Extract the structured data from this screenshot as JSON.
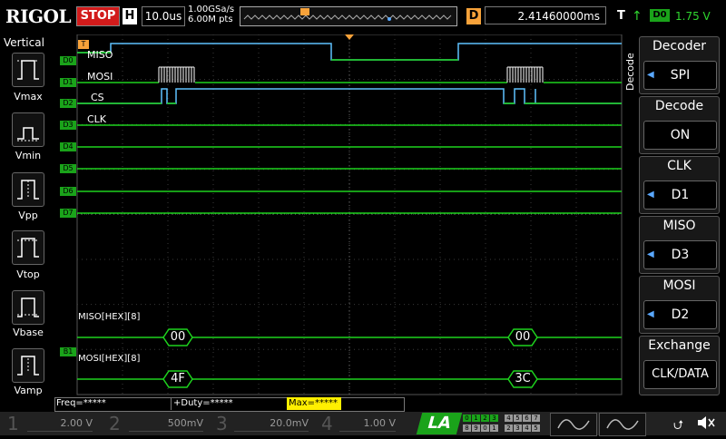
{
  "brand": "RIGOL",
  "run_state": "STOP",
  "horizontal": {
    "badge": "H",
    "timebase": "10.0us",
    "sample_rate": "1.00GSa/s",
    "memory": "6.00M pts"
  },
  "delay": {
    "badge": "D",
    "value": "2.41460000ms"
  },
  "trigger": {
    "badge": "T",
    "slope_icon": "rising-edge-icon",
    "source": "D0",
    "level": "1.75 V"
  },
  "vertical_menu": {
    "title": "Vertical",
    "items": [
      {
        "label": "Vmax"
      },
      {
        "label": "Vmin"
      },
      {
        "label": "Vpp"
      },
      {
        "label": "Vtop"
      },
      {
        "label": "Vbase"
      },
      {
        "label": "Vamp"
      }
    ]
  },
  "digital_channels": [
    {
      "id": "D0",
      "signal": "MISO"
    },
    {
      "id": "D1",
      "signal": "MOSI"
    },
    {
      "id": "D2",
      "signal": "CS"
    },
    {
      "id": "D3",
      "signal": "CLK"
    },
    {
      "id": "D4",
      "signal": ""
    },
    {
      "id": "D5",
      "signal": ""
    },
    {
      "id": "D6",
      "signal": ""
    },
    {
      "id": "D7",
      "signal": ""
    }
  ],
  "bus_markers": {
    "trigger_marker": "T",
    "bus_marker": "B1"
  },
  "decode_buses": [
    {
      "label": "MISO[HEX][8]",
      "frames": [
        "00",
        "00"
      ]
    },
    {
      "label": "MOSI[HEX][8]",
      "frames": [
        "4F",
        "3C"
      ]
    }
  ],
  "right_menu": {
    "tab": "Decode",
    "items": [
      {
        "title": "Decoder",
        "value": "SPI"
      },
      {
        "title": "Decode",
        "value": "ON"
      },
      {
        "title": "CLK",
        "value": "D1"
      },
      {
        "title": "MISO",
        "value": "D3"
      },
      {
        "title": "MOSI",
        "value": "D2"
      },
      {
        "title": "Exchange",
        "value": "CLK/DATA"
      }
    ]
  },
  "measurements": {
    "freq": "Freq=*****",
    "duty": "+Duty=*****",
    "max": "Max=*****"
  },
  "channels": [
    {
      "num": "1",
      "scale": "2.00 V"
    },
    {
      "num": "2",
      "scale": "500mV"
    },
    {
      "num": "3",
      "scale": "20.0mV"
    },
    {
      "num": "4",
      "scale": "1.00 V"
    }
  ],
  "la": {
    "label": "LA",
    "row1": [
      "0",
      "1",
      "2",
      "3",
      "4",
      "5",
      "6",
      "7"
    ],
    "row2": [
      "8",
      "9",
      "0",
      "1",
      "2",
      "3",
      "4",
      "5"
    ]
  },
  "status_icons": {
    "usb": "usb-icon",
    "sound": "mute-speaker-icon"
  },
  "colors": {
    "trace": "#1ed21e",
    "cs_trace": "#5fc3ff",
    "stop": "#d21b1b",
    "delay": "#f7a23a",
    "la": "#1aa31a"
  }
}
